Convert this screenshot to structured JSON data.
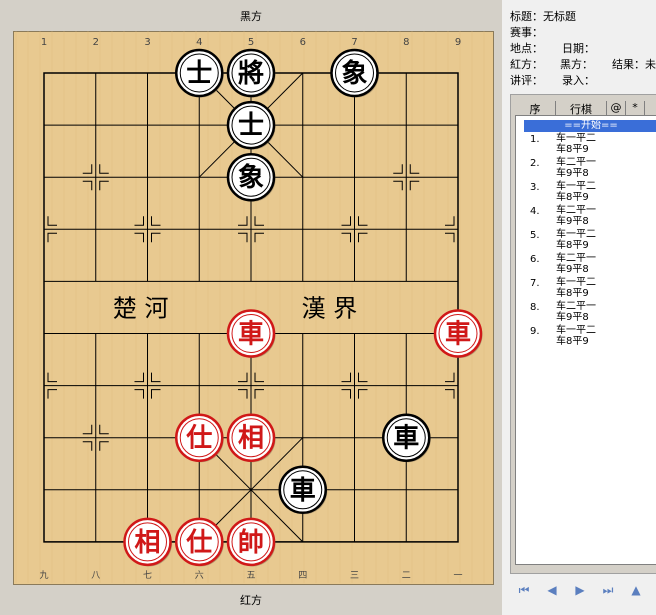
{
  "board": {
    "top_side": "黑方",
    "bottom_side": "红方",
    "top_files": [
      "1",
      "2",
      "3",
      "4",
      "5",
      "6",
      "7",
      "8",
      "9"
    ],
    "bottom_files": [
      "九",
      "八",
      "七",
      "六",
      "五",
      "四",
      "三",
      "二",
      "一"
    ],
    "river_left": "楚 河",
    "river_right": "漢 界",
    "pieces": [
      {
        "char": "士",
        "side": "black",
        "file": 4,
        "rank": 0
      },
      {
        "char": "將",
        "side": "black",
        "file": 5,
        "rank": 0
      },
      {
        "char": "象",
        "side": "black",
        "file": 7,
        "rank": 0
      },
      {
        "char": "士",
        "side": "black",
        "file": 5,
        "rank": 1
      },
      {
        "char": "象",
        "side": "black",
        "file": 5,
        "rank": 2
      },
      {
        "char": "車",
        "side": "red",
        "file": 5,
        "rank": 5
      },
      {
        "char": "車",
        "side": "red",
        "file": 9,
        "rank": 5
      },
      {
        "char": "仕",
        "side": "red",
        "file": 4,
        "rank": 7
      },
      {
        "char": "相",
        "side": "red",
        "file": 5,
        "rank": 7
      },
      {
        "char": "車",
        "side": "black",
        "file": 8,
        "rank": 7
      },
      {
        "char": "車",
        "side": "black",
        "file": 6,
        "rank": 8
      },
      {
        "char": "相",
        "side": "red",
        "file": 3,
        "rank": 9
      },
      {
        "char": "仕",
        "side": "red",
        "file": 4,
        "rank": 9
      },
      {
        "char": "帥",
        "side": "red",
        "file": 5,
        "rank": 9
      }
    ]
  },
  "info": {
    "title": "标题：无标题",
    "event": "赛事：",
    "place": "地点：",
    "date": "日期：",
    "red": "紅方：",
    "black": "黑方：",
    "result": "结果：未",
    "comment": "讲评：",
    "entry": "录入："
  },
  "moves": {
    "headers": [
      "序",
      "行棋",
      "@",
      "*"
    ],
    "start": "==开始==",
    "items": [
      {
        "num": "1.",
        "a": "车一平二",
        "b": "车8平9"
      },
      {
        "num": "2.",
        "a": "车二平一",
        "b": "车9平8"
      },
      {
        "num": "3.",
        "a": "车一平二",
        "b": "车8平9"
      },
      {
        "num": "4.",
        "a": "车二平一",
        "b": "车9平8"
      },
      {
        "num": "5.",
        "a": "车一平二",
        "b": "车8平9"
      },
      {
        "num": "6.",
        "a": "车二平一",
        "b": "车9平8"
      },
      {
        "num": "7.",
        "a": "车一平二",
        "b": "车8平9"
      },
      {
        "num": "8.",
        "a": "车二平一",
        "b": "车9平8"
      },
      {
        "num": "9.",
        "a": "车一平二",
        "b": "车8平9"
      }
    ]
  },
  "nav": [
    "⏮",
    "◀",
    "▶",
    "⏭",
    "▲"
  ],
  "colors": {
    "red": "#d01818",
    "black": "#000000",
    "board": "#e8c990"
  }
}
